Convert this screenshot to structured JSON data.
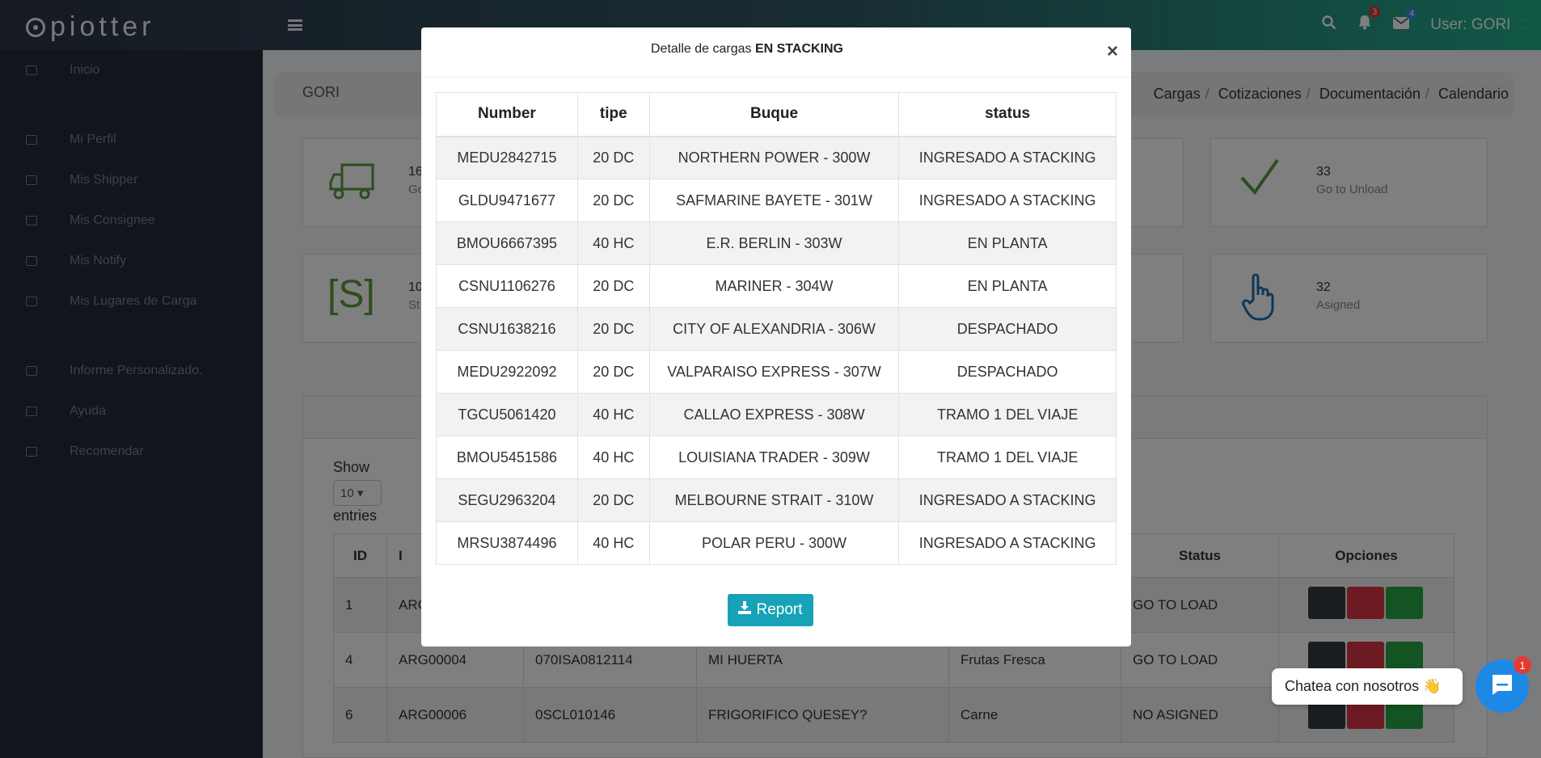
{
  "header": {
    "logo_text": "piotter",
    "notifications_count": "3",
    "messages_count": "4",
    "user_label": "User: GORI"
  },
  "sidebar": {
    "items": [
      {
        "label": "Inicio"
      },
      {
        "label": "Mi Perfil"
      },
      {
        "label": "Mis Shipper"
      },
      {
        "label": "Mis Consignee"
      },
      {
        "label": "Mis Notify"
      },
      {
        "label": "Mis Lugares de Carga"
      },
      {
        "label": "Informe Personalizado."
      },
      {
        "label": "Ayuda"
      },
      {
        "label": "Recomendar"
      }
    ]
  },
  "breadcrumb": {
    "left": "GORI",
    "links": [
      "Cargas",
      "Cotizaciones",
      "Documentación",
      "Calendario"
    ]
  },
  "cards": [
    {
      "number": "16",
      "label": "Go"
    },
    {
      "number": "33",
      "label": "Go to Unload"
    },
    {
      "number": "10",
      "label": "St"
    },
    {
      "number": "32",
      "label": "Asigned"
    }
  ],
  "list": {
    "show_label": "Show",
    "entries_value": "10",
    "entries_label": "entries",
    "columns": [
      "ID",
      "I",
      "",
      "",
      "",
      "Status",
      "Opciones"
    ],
    "rows": [
      {
        "id": "1",
        "code": "ARG",
        "ref": "",
        "name": "",
        "product": "",
        "status": "GO TO LOAD"
      },
      {
        "id": "4",
        "code": "ARG00004",
        "ref": "070ISA0812114",
        "name": "MI HUERTA",
        "product": "Frutas Fresca",
        "status": "GO TO LOAD"
      },
      {
        "id": "6",
        "code": "ARG00006",
        "ref": "0SCL010146",
        "name": "FRIGORIFICO QUESEY?",
        "product": "Carne",
        "status": "NO ASIGNED"
      }
    ]
  },
  "modal": {
    "title_prefix": "Detalle de cargas ",
    "title_bold": "EN STACKING",
    "close": "×",
    "columns": [
      "Number",
      "tipe",
      "Buque",
      "status"
    ],
    "rows": [
      {
        "number": "MEDU2842715",
        "tipe": "20 DC",
        "buque": "NORTHERN POWER - 300W",
        "status": "INGRESADO A STACKING"
      },
      {
        "number": "GLDU9471677",
        "tipe": "20 DC",
        "buque": "SAFMARINE BAYETE - 301W",
        "status": "INGRESADO A STACKING"
      },
      {
        "number": "BMOU6667395",
        "tipe": "40 HC",
        "buque": "E.R. BERLIN - 303W",
        "status": "EN PLANTA"
      },
      {
        "number": "CSNU1106276",
        "tipe": "20 DC",
        "buque": "MARINER - 304W",
        "status": "EN PLANTA"
      },
      {
        "number": "CSNU1638216",
        "tipe": "20 DC",
        "buque": "CITY OF ALEXANDRIA - 306W",
        "status": "DESPACHADO"
      },
      {
        "number": "MEDU2922092",
        "tipe": "20 DC",
        "buque": "VALPARAISO EXPRESS - 307W",
        "status": "DESPACHADO"
      },
      {
        "number": "TGCU5061420",
        "tipe": "40 HC",
        "buque": "CALLAO EXPRESS - 308W",
        "status": "TRAMO 1 DEL VIAJE"
      },
      {
        "number": "BMOU5451586",
        "tipe": "40 HC",
        "buque": "LOUISIANA TRADER - 309W",
        "status": "TRAMO 1 DEL VIAJE"
      },
      {
        "number": "SEGU2963204",
        "tipe": "20 DC",
        "buque": "MELBOURNE STRAIT - 310W",
        "status": "INGRESADO A STACKING"
      },
      {
        "number": "MRSU3874496",
        "tipe": "40 HC",
        "buque": "POLAR PERU - 300W",
        "status": "INGRESADO A STACKING"
      }
    ],
    "report_label": "Report"
  },
  "chat": {
    "bubble_text": "Chatea con nosotros 👋",
    "unread": "1"
  },
  "colors": {
    "accent": "#17a2b8",
    "sidebar_bg": "#242a38",
    "brand_green": "#23b08e"
  }
}
